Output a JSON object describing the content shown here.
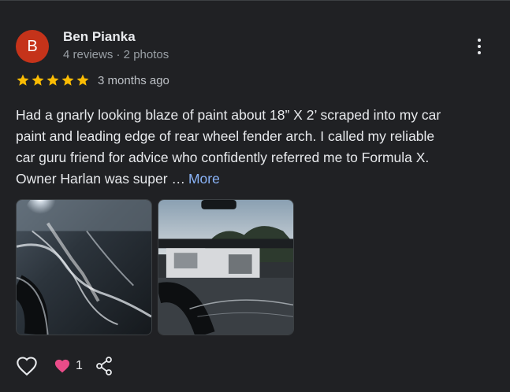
{
  "review": {
    "author": {
      "initial": "B",
      "name": "Ben Pianka",
      "meta": "4 reviews · 2 photos",
      "avatar_color": "#c5331a"
    },
    "rating": 5,
    "time_ago": "3 months ago",
    "text_lines": [
      "Had a gnarly looking blaze of paint about 18” X 2’ scraped into my car",
      "paint and leading edge of rear wheel fender arch. I called my reliable",
      "car guru friend for advice who confidently referred me to Formula X.",
      "Owner Harlan was super …"
    ],
    "more_label": "More",
    "photos": [
      "photo-scratch-closeup",
      "photo-fender-reflection"
    ],
    "reactions": {
      "like_icon": "heart-outline-icon",
      "heart_icon": "heart-filled-icon",
      "heart_count": "1",
      "share_icon": "share-icon"
    }
  },
  "colors": {
    "background": "#202124",
    "text": "#e8eaed",
    "muted": "#9aa0a6",
    "star": "#fbbc04",
    "link": "#8ab4f8",
    "heart": "#ea4c89"
  }
}
